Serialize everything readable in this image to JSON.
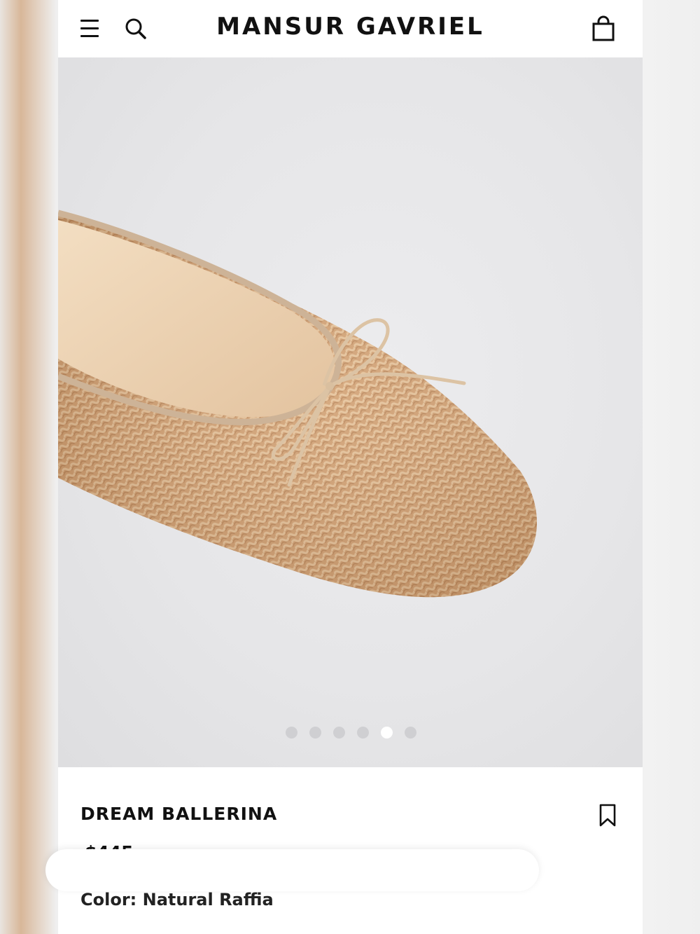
{
  "header": {
    "brand": "MANSUR GAVRIEL",
    "menu_icon": "hamburger-icon",
    "search_icon": "search-icon",
    "bag_icon": "shopping-bag-icon"
  },
  "gallery": {
    "image_alt": "Dream Ballerina raffia flat with bow",
    "slide_count": 6,
    "active_slide": 5
  },
  "product": {
    "title": "DREAM BALLERINA",
    "price": "$445",
    "color_label": "Color:",
    "color_value": "Natural Raffia",
    "bookmark_icon": "bookmark-icon"
  },
  "colors": {
    "raffia": "#d6a778",
    "lining": "#ecd3b3",
    "trim": "#cdb397"
  }
}
